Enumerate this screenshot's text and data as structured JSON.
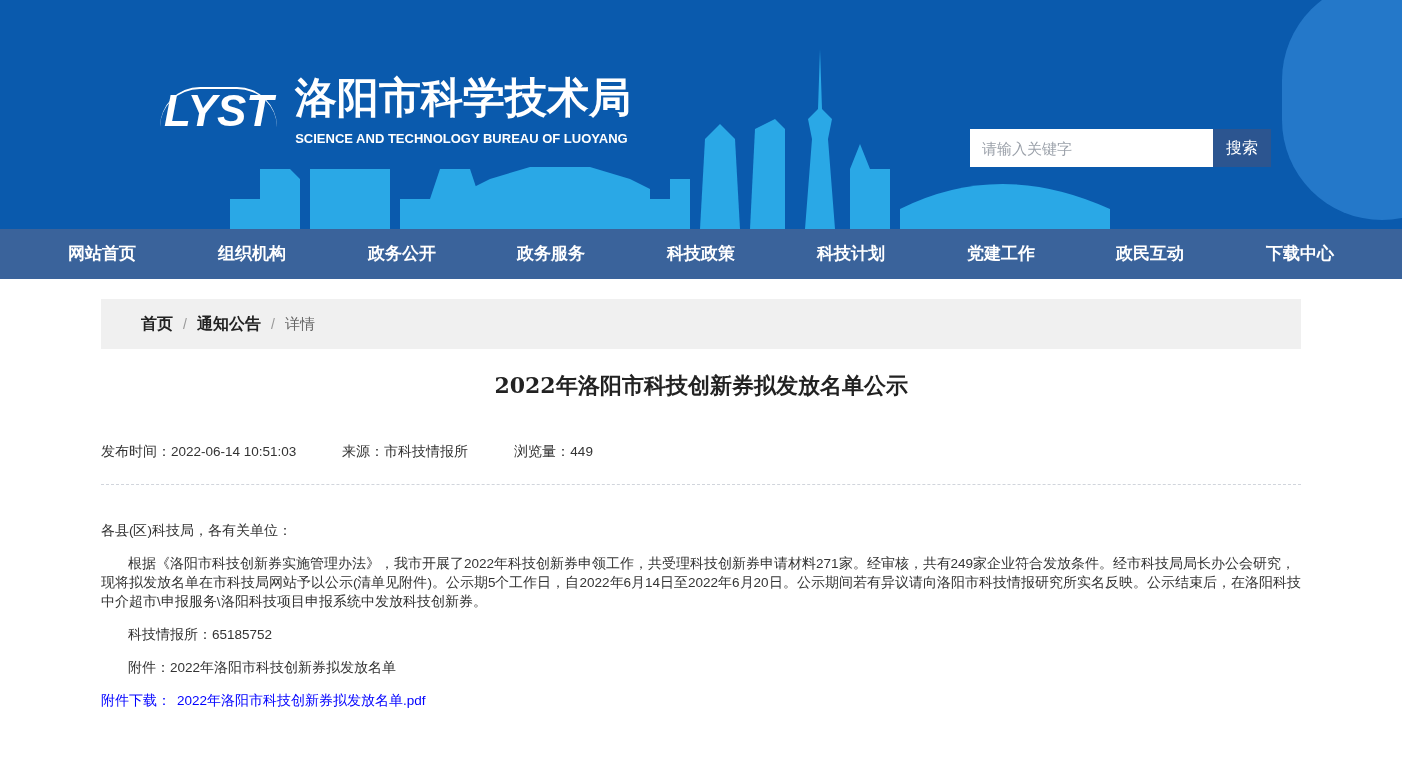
{
  "header": {
    "logo_text": "LYST",
    "title": "洛阳市科学技术局",
    "subtitle": "SCIENCE AND TECHNOLOGY BUREAU OF LUOYANG",
    "search": {
      "placeholder": "请输入关键字",
      "button": "搜索"
    }
  },
  "nav": [
    "网站首页",
    "组织机构",
    "政务公开",
    "政务服务",
    "科技政策",
    "科技计划",
    "党建工作",
    "政民互动",
    "下载中心"
  ],
  "breadcrumb": {
    "separator": "/",
    "items": [
      {
        "label": "首页",
        "kind": "link"
      },
      {
        "label": "通知公告",
        "kind": "link"
      },
      {
        "label": "详情",
        "kind": "current"
      }
    ]
  },
  "article": {
    "title": "2022年洛阳市科技创新券拟发放名单公示",
    "meta": [
      "发布时间：2022-06-14 10:51:03",
      "来源：市科技情报所",
      "浏览量：449"
    ],
    "paragraphs": [
      {
        "text": "各县(区)科技局，各有关单位：",
        "indent": false
      },
      {
        "text": "根据《洛阳市科技创新券实施管理办法》，我市开展了2022年科技创新券申领工作，共受理科技创新券申请材料271家。经审核，共有249家企业符合发放条件。经市科技局局长办公会研究，现将拟发放名单在市科技局网站予以公示(清单见附件)。公示期5个工作日，自2022年6月14日至2022年6月20日。公示期间若有异议请向洛阳市科技情报研究所实名反映。公示结束后，在洛阳科技中介超市\\申报服务\\洛阳科技项目申报系统中发放科技创新券。",
        "indent": true
      },
      {
        "text": "科技情报所：65185752",
        "indent": true
      },
      {
        "text": "附件：2022年洛阳市科技创新券拟发放名单",
        "indent": true
      }
    ],
    "attachment": {
      "label": "附件下载：",
      "file": "2022年洛阳市科技创新券拟发放名单.pdf"
    }
  }
}
